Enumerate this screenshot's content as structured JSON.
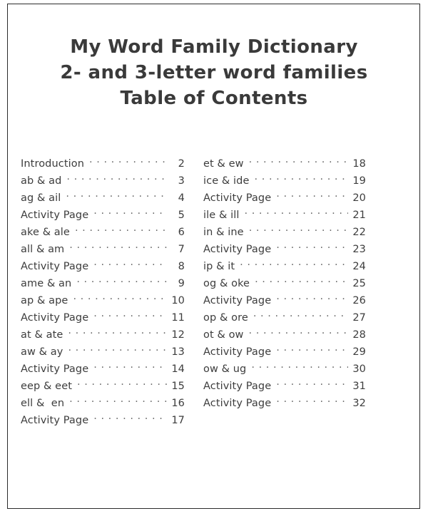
{
  "document": {
    "title_lines": [
      "My Word Family Dictionary",
      "2- and 3-letter word families",
      "Table of Contents"
    ],
    "border_color": "#2b2b2b",
    "text_color": "#3d3d3d",
    "leader_color": "#6a6a6a",
    "background_color": "#ffffff"
  },
  "toc": {
    "left_column": [
      {
        "label": "Introduction",
        "page": "2"
      },
      {
        "label": "ab & ad",
        "page": "3"
      },
      {
        "label": "ag & ail",
        "page": "4"
      },
      {
        "label": "Activity Page",
        "page": "5"
      },
      {
        "label": "ake & ale",
        "page": "6"
      },
      {
        "label": "all & am",
        "page": "7"
      },
      {
        "label": "Activity Page",
        "page": "8"
      },
      {
        "label": "ame & an",
        "page": "9"
      },
      {
        "label": "ap & ape",
        "page": "10"
      },
      {
        "label": "Activity Page",
        "page": "11"
      },
      {
        "label": "at & ate",
        "page": "12"
      },
      {
        "label": "aw & ay",
        "page": "13"
      },
      {
        "label": "Activity Page",
        "page": "14"
      },
      {
        "label": "eep & eet",
        "page": "15"
      },
      {
        "label": "ell &  en",
        "page": "16"
      },
      {
        "label": "Activity Page",
        "page": "17"
      }
    ],
    "right_column": [
      {
        "label": "et & ew",
        "page": "18"
      },
      {
        "label": "ice & ide",
        "page": "19"
      },
      {
        "label": "Activity Page",
        "page": "20"
      },
      {
        "label": "ile & ill",
        "page": "21"
      },
      {
        "label": "in & ine",
        "page": "22"
      },
      {
        "label": "Activity Page",
        "page": "23"
      },
      {
        "label": "ip & it",
        "page": "24"
      },
      {
        "label": "og & oke",
        "page": "25"
      },
      {
        "label": "Activity Page",
        "page": "26"
      },
      {
        "label": "op & ore",
        "page": "27"
      },
      {
        "label": "ot & ow",
        "page": "28"
      },
      {
        "label": "Activity Page",
        "page": "29"
      },
      {
        "label": "ow & ug",
        "page": "30"
      },
      {
        "label": "Activity Page",
        "page": "31"
      },
      {
        "label": "Activity Page",
        "page": "32"
      }
    ]
  }
}
